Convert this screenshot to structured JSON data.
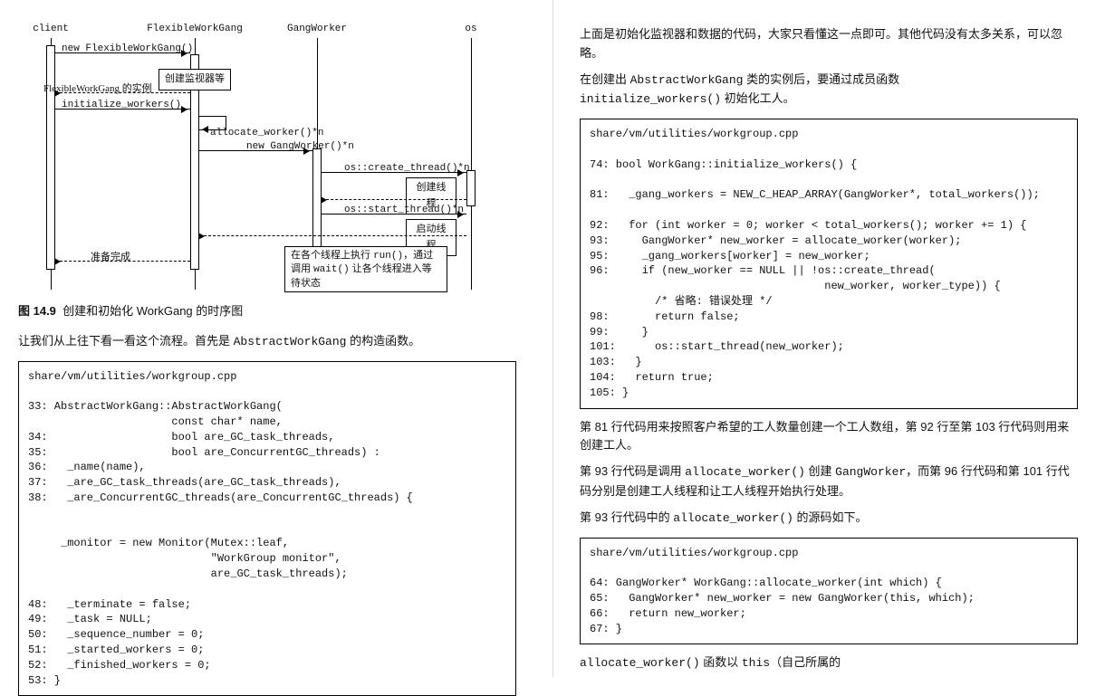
{
  "seq": {
    "l1": "client",
    "l2": "FlexibleWorkGang",
    "l3": "GangWorker",
    "l4": "os",
    "m_new": "new FlexibleWorkGang()",
    "m_inst": "FlexibleWorkGang 的实例",
    "m_init": "initialize_workers()",
    "m_alloc": "allocate_worker()*n",
    "m_newgw": "new GangWorker()*n",
    "m_create": "os::create_thread()*n",
    "m_start": "os::start_thread()*n",
    "n_mon": "创建监视器等",
    "n_cthread": "创建线程",
    "n_sthread": "启动线程",
    "m_ready": "准备完成",
    "n_wait_l1": "在各个线程上执行 ",
    "n_wait_run": "run()",
    "n_wait_l2": "，通过调用 ",
    "n_wait_wait": "wait()",
    "n_wait_l3": " 让各个线程进入等待状态"
  },
  "left": {
    "fig_b": "图 14.9",
    "fig_t": "创建和初始化 WorkGang 的时序图",
    "p1a": "让我们从上往下看一看这个流程。首先是 ",
    "p1b": "AbstractWorkGang",
    "p1c": " 的构造函数。",
    "code1_file": "share/vm/utilities/workgroup.cpp",
    "code1": "33: AbstractWorkGang::AbstractWorkGang(\n                      const char* name,\n34:                   bool are_GC_task_threads,\n35:                   bool are_ConcurrentGC_threads) :\n36:   _name(name),\n37:   _are_GC_task_threads(are_GC_task_threads),\n38:   _are_ConcurrentGC_threads(are_ConcurrentGC_threads) {\n\n\n     _monitor = new Monitor(Mutex::leaf,\n                            \"WorkGroup monitor\",\n                            are_GC_task_threads);\n\n48:   _terminate = false;\n49:   _task = NULL;\n50:   _sequence_number = 0;\n51:   _started_workers = 0;\n52:   _finished_workers = 0;\n53: }"
  },
  "right": {
    "p1": "上面是初始化监视器和数据的代码，大家只看懂这一点即可。其他代码没有太多关系，可以忽略。",
    "p2a": "在创建出 ",
    "p2b": "AbstractWorkGang",
    "p2c": " 类的实例后，要通过成员函数 ",
    "p2d": "initialize_workers()",
    "p2e": " 初始化工人。",
    "code1_file": "share/vm/utilities/workgroup.cpp",
    "code1": "74: bool WorkGang::initialize_workers() {\n\n81:   _gang_workers = NEW_C_HEAP_ARRAY(GangWorker*, total_workers());\n\n92:   for (int worker = 0; worker < total_workers(); worker += 1) {\n93:     GangWorker* new_worker = allocate_worker(worker);\n95:     _gang_workers[worker] = new_worker;\n96:     if (new_worker == NULL || !os::create_thread(\n                                    new_worker, worker_type)) {\n          /* 省略: 错误处理 */\n98:       return false;\n99:     }\n101:      os::start_thread(new_worker);\n103:   }\n104:   return true;\n105: }",
    "p3": "第 81 行代码用来按照客户希望的工人数量创建一个工人数组，第 92 行至第 103 行代码则用来创建工人。",
    "p4a": "第 93 行代码是调用 ",
    "p4b": "allocate_worker()",
    "p4c": " 创建 ",
    "p4d": "GangWorker",
    "p4e": "，而第 96 行代码和第 101 行代码分别是创建工人线程和让工人线程开始执行处理。",
    "p5a": "第 93 行代码中的 ",
    "p5b": "allocate_worker()",
    "p5c": " 的源码如下。",
    "code2_file": "share/vm/utilities/workgroup.cpp",
    "code2": "64: GangWorker* WorkGang::allocate_worker(int which) {\n65:   GangWorker* new_worker = new GangWorker(this, which);\n66:   return new_worker;\n67: }",
    "p6a": "allocate_worker()",
    "p6b": " 函数以 ",
    "p6c": "this",
    "p6d": "（自己所属的"
  }
}
